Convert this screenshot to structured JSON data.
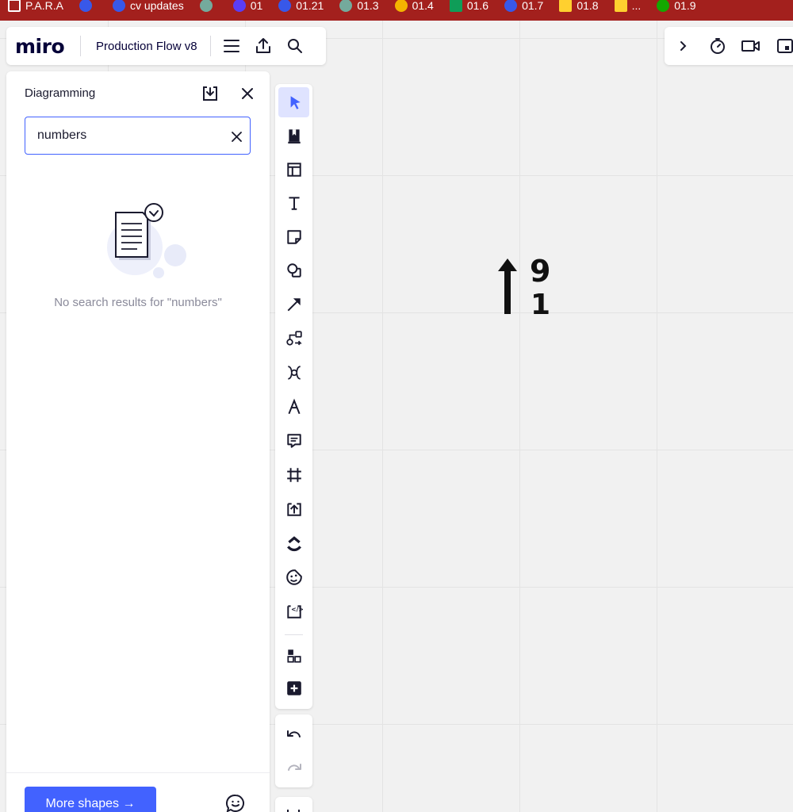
{
  "browser": {
    "bookmarks": [
      {
        "label": "P.A.R.A",
        "icon": "folder-icon",
        "color": "#ffffff"
      },
      {
        "label": "",
        "icon": "wordpress-icon",
        "color": "#3858e9"
      },
      {
        "label": "cv updates",
        "icon": "wordpress-icon",
        "color": "#3858e9"
      },
      {
        "label": "",
        "icon": "chatgpt-icon",
        "color": "#74aa9c"
      },
      {
        "label": "01",
        "icon": "app-icon",
        "color": "#5b3df5"
      },
      {
        "label": "01.21",
        "icon": "app-icon",
        "color": "#3858e9"
      },
      {
        "label": "01.3",
        "icon": "chatgpt-icon",
        "color": "#74aa9c"
      },
      {
        "label": "01.4",
        "icon": "google-drive-icon",
        "color": "#f4b400"
      },
      {
        "label": "01.6",
        "icon": "google-sheets-icon",
        "color": "#0f9d58"
      },
      {
        "label": "01.7",
        "icon": "wordpress-icon",
        "color": "#3858e9"
      },
      {
        "label": "01.8",
        "icon": "miro-icon",
        "color": "#ffd02f"
      },
      {
        "label": "...",
        "icon": "miro-icon",
        "color": "#ffd02f"
      },
      {
        "label": "01.9",
        "icon": "upwork-icon",
        "color": "#14a800"
      }
    ]
  },
  "header": {
    "logo": "miro",
    "board_name": "Production Flow v8"
  },
  "panel": {
    "title": "Diagramming",
    "search_value": "numbers",
    "empty_message": "No search results for \"numbers\"",
    "more_button": "More shapes →"
  },
  "toolbar": {
    "tools": [
      {
        "name": "select",
        "icon": "cursor-icon",
        "active": true
      },
      {
        "name": "templates",
        "icon": "bookmark-template-icon",
        "active": false
      },
      {
        "name": "layouts",
        "icon": "layout-icon",
        "active": false
      },
      {
        "name": "text",
        "icon": "text-icon",
        "active": false
      },
      {
        "name": "sticky-note",
        "icon": "sticky-note-icon",
        "active": false
      },
      {
        "name": "shapes",
        "icon": "shapes-icon",
        "active": false
      },
      {
        "name": "connection-line",
        "icon": "arrow-line-icon",
        "active": false
      },
      {
        "name": "diagramming",
        "icon": "diagram-icon",
        "active": false
      },
      {
        "name": "mind-map",
        "icon": "mindmap-icon",
        "active": false
      },
      {
        "name": "pen",
        "icon": "pen-icon",
        "active": false
      },
      {
        "name": "comment",
        "icon": "comment-icon",
        "active": false
      },
      {
        "name": "frame",
        "icon": "frame-icon",
        "active": false
      },
      {
        "name": "upload",
        "icon": "upload-icon",
        "active": false
      },
      {
        "name": "clickup",
        "icon": "clickup-icon",
        "active": false
      },
      {
        "name": "stickers",
        "icon": "sticker-icon",
        "active": false
      },
      {
        "name": "embed",
        "icon": "embed-icon",
        "active": false
      },
      {
        "name": "apps",
        "icon": "apps-icon",
        "active": false
      },
      {
        "name": "more-tools",
        "icon": "plus-icon",
        "active": false
      }
    ]
  },
  "colors": {
    "accent": "#4262ff",
    "bookmark_bar": "#a3201d",
    "active_tool_bg": "#dfe3ff"
  }
}
